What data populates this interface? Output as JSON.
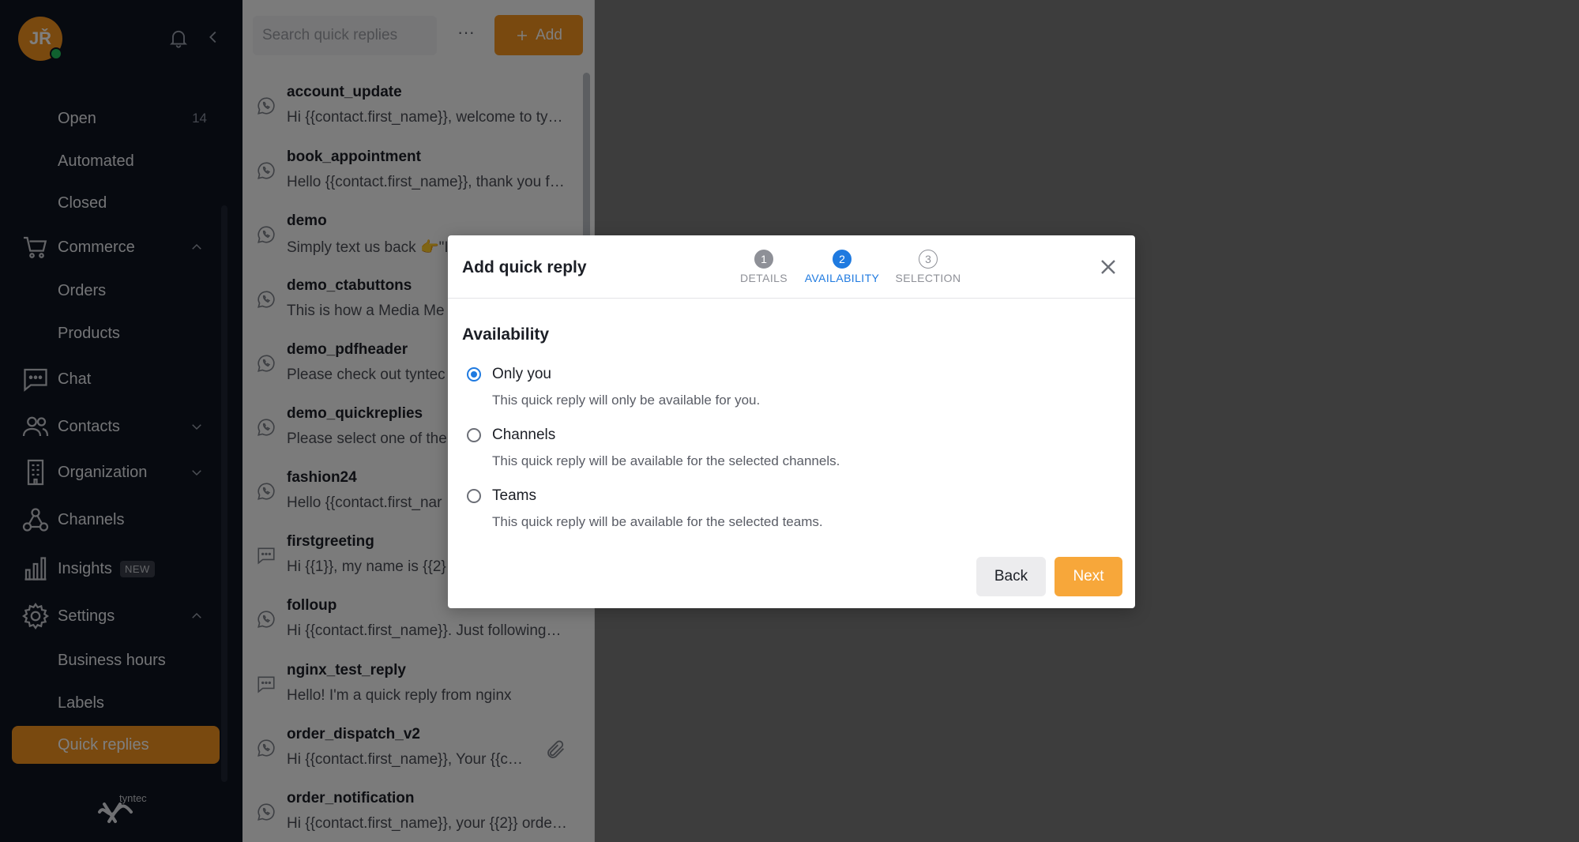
{
  "user": {
    "initials": "JŘ"
  },
  "sidebar": {
    "items": [
      {
        "label": "Open",
        "count": "14"
      },
      {
        "label": "Automated"
      },
      {
        "label": "Closed"
      },
      {
        "label": "Commerce"
      },
      {
        "label": "Orders"
      },
      {
        "label": "Products"
      },
      {
        "label": "Chat"
      },
      {
        "label": "Contacts"
      },
      {
        "label": "Organization"
      },
      {
        "label": "Channels"
      },
      {
        "label": "Insights",
        "badge": "NEW"
      },
      {
        "label": "Settings"
      },
      {
        "label": "Business hours"
      },
      {
        "label": "Labels"
      },
      {
        "label": "Quick replies"
      }
    ],
    "brand": "tyntec"
  },
  "quick_replies": {
    "search_placeholder": "Search quick replies",
    "more_label": "···",
    "add_label": "Add",
    "items": [
      {
        "name": "account_update",
        "text": "Hi {{contact.first_name}}, welcome to ty…",
        "icon": "whatsapp-icon"
      },
      {
        "name": "book_appointment",
        "text": "Hello {{contact.first_name}}, thank you f…",
        "icon": "whatsapp-icon"
      },
      {
        "name": "demo",
        "text": "Simply text us back 👉\"I",
        "icon": "whatsapp-icon"
      },
      {
        "name": "demo_ctabuttons",
        "text": "This is how a Media Me",
        "icon": "whatsapp-icon"
      },
      {
        "name": "demo_pdfheader",
        "text": "Please check out tyntec",
        "icon": "whatsapp-icon"
      },
      {
        "name": "demo_quickreplies",
        "text": "Please select one of the",
        "icon": "whatsapp-icon"
      },
      {
        "name": "fashion24",
        "text": "Hello {{contact.first_nar",
        "icon": "whatsapp-icon"
      },
      {
        "name": "firstgreeting",
        "text": "Hi {{1}}, my name is {{2}",
        "icon": "chat-bubble-icon"
      },
      {
        "name": "folloup",
        "text": "Hi {{contact.first_name}}. Just following…",
        "icon": "whatsapp-icon"
      },
      {
        "name": "nginx_test_reply",
        "text": "Hello! I'm a quick reply from nginx",
        "icon": "chat-bubble-icon"
      },
      {
        "name": "order_dispatch_v2",
        "text": "Hi {{contact.first_name}}, Your {{co…",
        "icon": "whatsapp-icon"
      },
      {
        "name": "order_notification",
        "text": "Hi {{contact.first_name}}, your {{2}} orde…",
        "icon": "whatsapp-icon"
      }
    ]
  },
  "modal": {
    "title": "Add quick reply",
    "steps": [
      {
        "number": "1",
        "label": "DETAILS"
      },
      {
        "number": "2",
        "label": "AVAILABILITY"
      },
      {
        "number": "3",
        "label": "SELECTION"
      }
    ],
    "section_title": "Availability",
    "options": [
      {
        "label": "Only you",
        "description": "This quick reply will only be available for you.",
        "selected": true
      },
      {
        "label": "Channels",
        "description": "This quick reply will be available for the selected channels.",
        "selected": false
      },
      {
        "label": "Teams",
        "description": "This quick reply will be available for the selected teams.",
        "selected": false
      }
    ],
    "back_label": "Back",
    "next_label": "Next"
  },
  "colors": {
    "accent": "#f2921f",
    "primary": "#1f7ae0",
    "sidebar_bg": "#0f1420"
  }
}
